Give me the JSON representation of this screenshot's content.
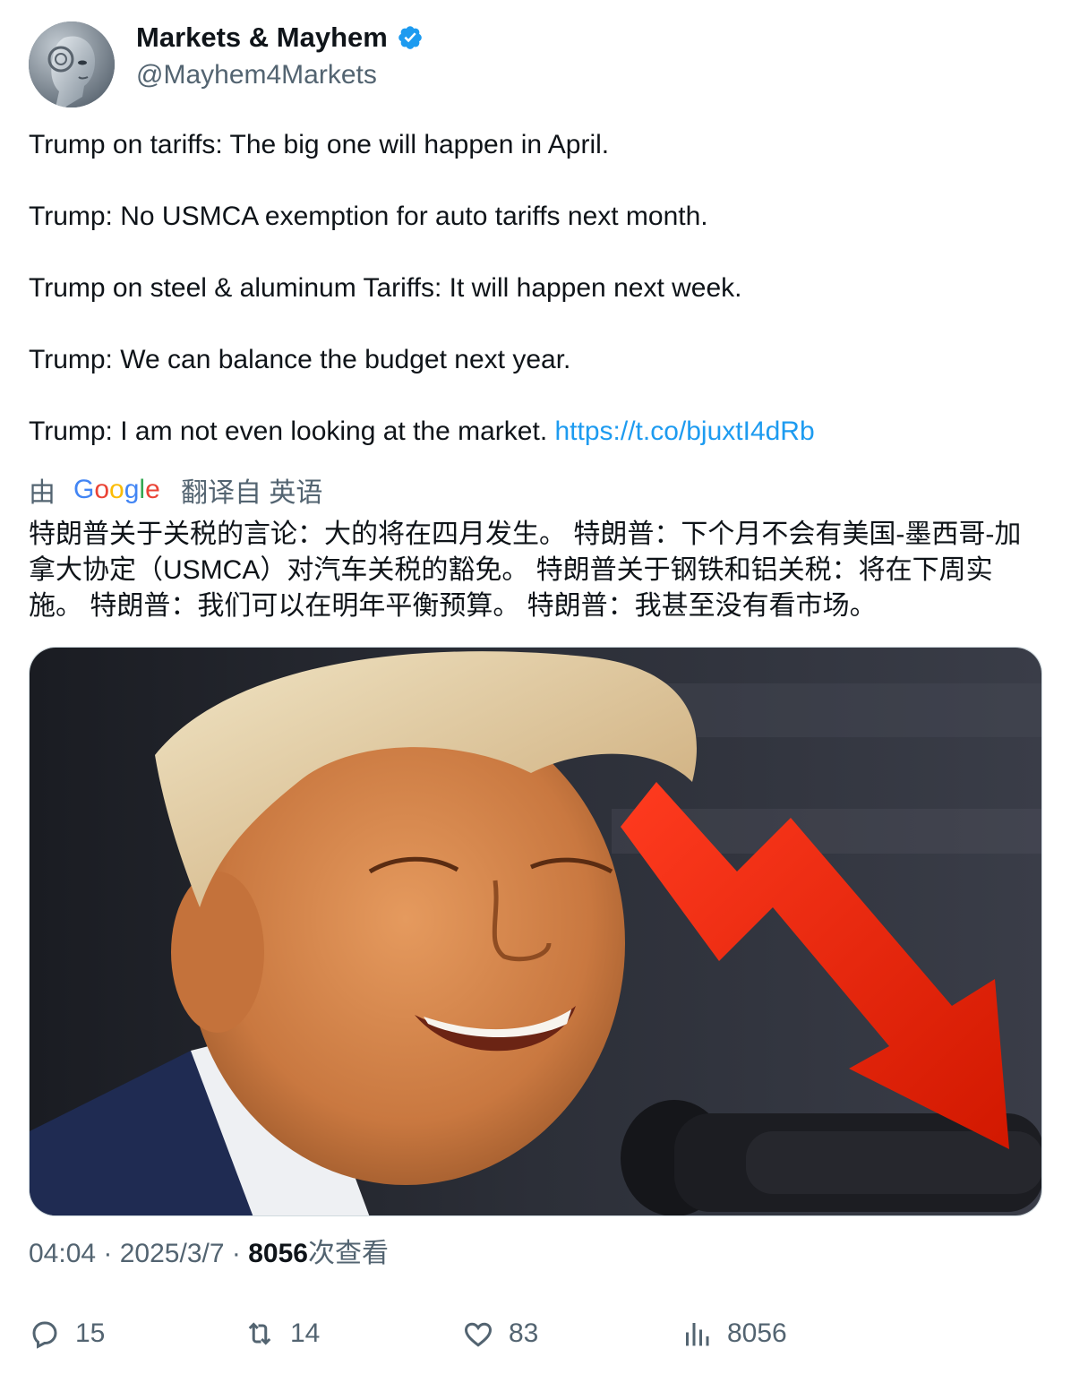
{
  "author": {
    "display_name": "Markets & Mayhem",
    "handle": "@Mayhem4Markets",
    "verified": true,
    "verified_color": "#1d9bf0"
  },
  "tweet": {
    "lines": [
      "Trump on tariffs: The big one will happen in April.",
      "Trump: No USMCA exemption for auto tariffs next month.",
      "Trump on steel & aluminum Tariffs: It will happen next week.",
      "Trump: We can balance the budget next year.",
      "Trump: I am not even looking at the market."
    ],
    "link": "https://t.co/bjuxtI4dRb",
    "link_color": "#1d9bf0"
  },
  "translation": {
    "prefix": "由",
    "provider": "Google",
    "suffix": "翻译自 英语",
    "text": "特朗普关于关税的言论：大的将在四月发生。 特朗普：下个月不会有美国-墨西哥-加拿大协定（USMCA）对汽车关税的豁免。 特朗普关于钢铁和铝关税：将在下周实施。 特朗普：我们可以在明年平衡预算。 特朗普：我甚至没有看市场。"
  },
  "media": {
    "description_icon": "photo-icon",
    "arrow_color": "#e8200c"
  },
  "meta": {
    "time": "04:04",
    "separator": " · ",
    "date": "2025/3/7",
    "views_count": "8056",
    "views_label": "次查看"
  },
  "actions": {
    "reply_icon": "reply-icon",
    "reply_count": "15",
    "retweet_icon": "retweet-icon",
    "retweet_count": "14",
    "like_icon": "heart-icon",
    "like_count": "83",
    "views_icon": "analytics-icon",
    "views_count": "8056"
  }
}
